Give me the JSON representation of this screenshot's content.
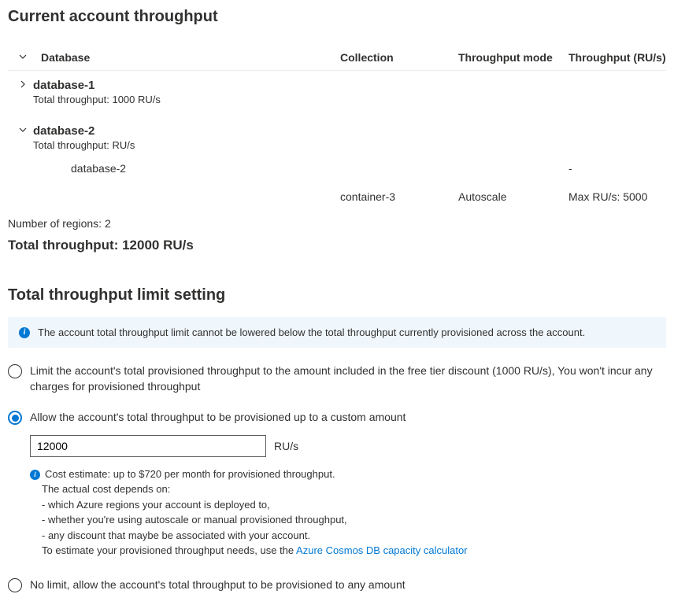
{
  "headings": {
    "main": "Current account throughput",
    "limit_setting": "Total throughput limit setting"
  },
  "table": {
    "headers": {
      "database": "Database",
      "collection": "Collection",
      "mode": "Throughput mode",
      "throughput": "Throughput (RU/s)"
    },
    "databases": [
      {
        "name": "database-1",
        "subtitle": "Total throughput: 1000 RU/s",
        "expanded": false
      },
      {
        "name": "database-2",
        "subtitle": "Total throughput: RU/s",
        "expanded": true,
        "children": [
          {
            "database": "database-2",
            "collection": "",
            "mode": "",
            "throughput": "-"
          },
          {
            "database": "",
            "collection": "container-3",
            "mode": "Autoscale",
            "throughput": "Max RU/s: 5000"
          }
        ]
      }
    ]
  },
  "summary": {
    "regions_label": "Number of regions: 2",
    "total_label": "Total throughput: 12000 RU/s"
  },
  "info_bar": {
    "text": "The account total throughput limit cannot be lowered below the total throughput currently provisioned across the account."
  },
  "options": {
    "free_tier": "Limit the account's total provisioned throughput to the amount included in the free tier discount (1000 RU/s), You won't incur any charges for provisioned throughput",
    "custom": "Allow the account's total throughput to be provisioned up to a custom amount",
    "custom_value": "12000",
    "custom_suffix": "RU/s",
    "no_limit": "No limit, allow the account's total throughput to be provisioned to any amount"
  },
  "cost": {
    "line1": "Cost estimate: up to $720 per month for provisioned throughput.",
    "line2": "The actual cost depends on:",
    "line3": "- which Azure regions your account is deployed to,",
    "line4": "- whether you're using autoscale or manual provisioned throughput,",
    "line5": "- any discount that maybe be associated with your account.",
    "line6_prefix": "To estimate your provisioned throughput needs, use the ",
    "link_text": "Azure Cosmos DB capacity calculator"
  }
}
